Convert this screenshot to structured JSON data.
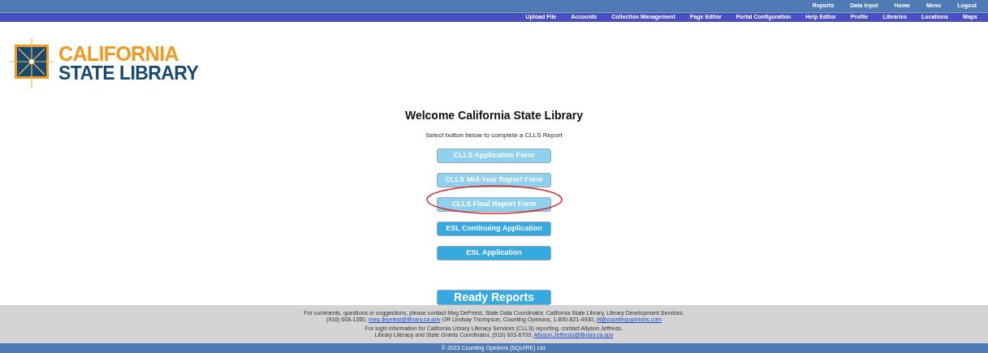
{
  "top_menu": [
    "Reports",
    "Data Input",
    "Home",
    "Menu",
    "Logout"
  ],
  "nav_menu": [
    "Upload File",
    "Accounts",
    "Collection Management",
    "Page Editor",
    "Portal Configuration",
    "Help Editor",
    "Profile",
    "Libraries",
    "Locations",
    "Maps"
  ],
  "logo": {
    "line_1": "CALIFORNIA",
    "line_2": "STATE LIBRARY"
  },
  "heading": "Welcome California State Library",
  "instruction": "Select button below to complete a CLLS Report",
  "form_buttons": [
    {
      "label": "CLLS Application Form",
      "disabled": true,
      "circled": false
    },
    {
      "label": "CLLS Mid-Year Report Form",
      "disabled": true,
      "circled": false
    },
    {
      "label": "CLLS Final Report Form",
      "disabled": true,
      "circled": true
    },
    {
      "label": "ESL Continuing Application",
      "disabled": false,
      "circled": false
    },
    {
      "label": "ESL Application",
      "disabled": false,
      "circled": false
    }
  ],
  "ready_button": "Ready Reports",
  "footer": {
    "paragraphs": [
      {
        "lines": [
          [
            {
              "text": "For comments, questions or suggestions, please contact Meg DePriest, State Data Coordinator, California State Library, Library Development Services.",
              "link": false
            }
          ],
          [
            {
              "text": "(916) 608-1350, ",
              "link": false
            },
            {
              "text": "meg.depriest@library.ca.gov",
              "link": true
            },
            {
              "text": " OR Lindsay Thompson, Counting Opinions, 1-800-821-4930, ",
              "link": false
            },
            {
              "text": "lit@countingopinions.com",
              "link": true
            }
          ]
        ]
      },
      {
        "lines": [
          [
            {
              "text": "For login information for California Library Literacy Services (CLLS) reporting, contact Allyson Jeffredo,",
              "link": false
            }
          ],
          [
            {
              "text": "Library Literacy and State Grants Coordinator, (916) 603-6709, ",
              "link": false
            },
            {
              "text": "Allyson.Jeffredo@library.ca.gov",
              "link": true
            }
          ]
        ]
      }
    ],
    "copyright": "© 2023 Counting Opinions (SQUIRE) Ltd."
  }
}
